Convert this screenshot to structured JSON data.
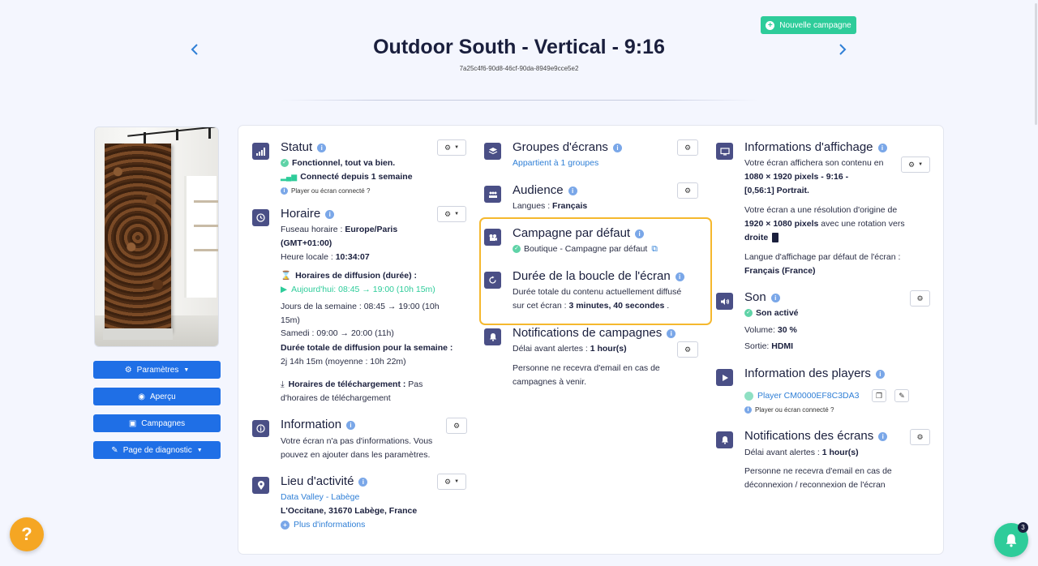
{
  "header": {
    "title": "Outdoor South - Vertical - 9:16",
    "uuid": "7a25c4f6-90d8-46cf-90da-8949e9cce5e2",
    "new_campaign_label": "Nouvelle campagne"
  },
  "sidebar": {
    "buttons": [
      {
        "label": "Paramètres",
        "icon": "gears-icon"
      },
      {
        "label": "Aperçu",
        "icon": "eye-icon"
      },
      {
        "label": "Campagnes",
        "icon": "film-icon"
      },
      {
        "label": "Page de diagnostic",
        "icon": "wrench-icon"
      }
    ]
  },
  "statut": {
    "title": "Statut",
    "line1": "Fonctionnel, tout va bien.",
    "line2": "Connecté depuis 1 semaine",
    "help": "Player ou écran connecté ?"
  },
  "horaire": {
    "title": "Horaire",
    "tz_label": "Fuseau horaire : ",
    "tz_value": "Europe/Paris",
    "tz_value2": "(GMT+01:00)",
    "local_label": "Heure locale : ",
    "local_value": "10:34:07",
    "diffusion_title": "Horaires de diffusion (durée) :",
    "today": "Aujourd'hui: 08:45 → 19:00 (10h 15m)",
    "weekdays": "Jours de la semaine : 08:45 → 19:00 (10h",
    "weekdays2": "15m)",
    "saturday": "Samedi : 09:00 → 20:00 (11h)",
    "total_label": "Durée totale de diffusion pour la semaine :",
    "total_value": "2j 14h 15m (moyenne : 10h 22m)",
    "download_label": "Horaires de téléchargement : ",
    "download_value": "Pas",
    "download_value2": "d'horaires de téléchargement"
  },
  "information": {
    "title": "Information",
    "text1": "Votre écran n'a pas d'informations. Vous",
    "text2": "pouvez en ajouter dans les paramètres."
  },
  "lieu": {
    "title": "Lieu d'activité",
    "name": "Data Valley - Labège",
    "address": "L'Occitane, 31670 Labège, France",
    "more": "Plus d'informations"
  },
  "groupes": {
    "title": "Groupes d'écrans",
    "value": "Appartient à 1 groupes"
  },
  "audience": {
    "title": "Audience",
    "label": "Langues : ",
    "value": "Français"
  },
  "campagne_defaut": {
    "title": "Campagne par défaut",
    "value": "Boutique - Campagne par défaut"
  },
  "boucle": {
    "title": "Durée de la boucle de l'écran",
    "text1": "Durée totale du contenu actuellement diffusé",
    "text2_label": "sur cet écran : ",
    "text2_value": "3 minutes, 40 secondes",
    "text2_end": " ."
  },
  "notif_campagnes": {
    "title": "Notifications de campagnes",
    "delay_label": "Délai avant alertes : ",
    "delay_value": "1 hour(s)",
    "text1": "Personne ne recevra d'email en cas de",
    "text2": "campagnes à venir."
  },
  "affichage": {
    "title": "Informations d'affichage",
    "l1": "Votre écran affichera son contenu en",
    "l2": "1080 × 1920 pixels - 9:16 -",
    "l3": "[0,56:1] Portrait.",
    "l4": "Votre écran a une résolution d'origine de",
    "l5_value": "1920  × 1080 pixels",
    "l5_rest": " avec une rotation vers",
    "l6": "droite",
    "l7": "Langue d'affichage par défaut de l'écran :",
    "l8": "Français (France)"
  },
  "son": {
    "title": "Son",
    "status": "Son activé",
    "volume_label": "Volume: ",
    "volume_value": "30 %",
    "output_label": "Sortie: ",
    "output_value": "HDMI"
  },
  "players": {
    "title": "Information des players",
    "player": "Player CM0000EF8C3DA3",
    "help": "Player ou écran connecté ?"
  },
  "notif_ecrans": {
    "title": "Notifications des écrans",
    "delay_label": "Délai avant alertes : ",
    "delay_value": "1 hour(s)",
    "text1": "Personne ne recevra d'email en cas de",
    "text2": "déconnexion / reconnexion de l'écran"
  },
  "notifications_count": "3",
  "help_label": "?",
  "colors": {
    "primary": "#1f6fe6",
    "accent": "#2ecc9a",
    "highlight": "#f5b82e",
    "icon_bg": "#4a4f86"
  }
}
